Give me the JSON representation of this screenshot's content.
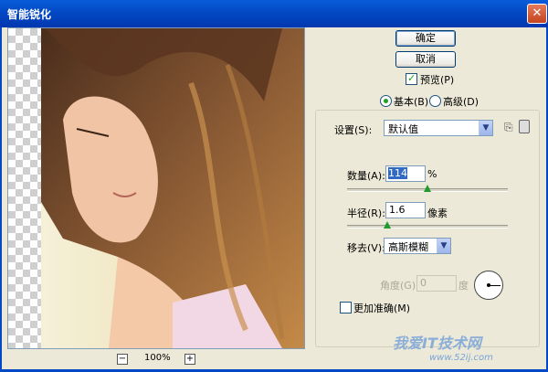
{
  "window": {
    "title": "智能锐化"
  },
  "preview": {
    "zoom": "100%"
  },
  "buttons": {
    "ok": "确定",
    "cancel": "取消"
  },
  "preview_check": {
    "label": "预览(P)",
    "checked": true
  },
  "mode": {
    "basic": "基本(B)",
    "advanced": "高级(D)",
    "selected": "basic"
  },
  "settings": {
    "label": "设置(S):",
    "value": "默认值"
  },
  "amount": {
    "label": "数量(A):",
    "value": "114",
    "unit": "%",
    "slider_fraction": 0.5
  },
  "radius": {
    "label": "半径(R):",
    "value": "1.6",
    "unit": "像素",
    "slider_fraction": 0.25
  },
  "remove": {
    "label": "移去(V):",
    "value": "高斯模糊"
  },
  "angle": {
    "label": "角度(G):",
    "value": "0",
    "unit": "度"
  },
  "accurate": {
    "label": "更加准确(M)",
    "checked": false
  },
  "watermark": {
    "text": "我爱IT技术网",
    "url": "www.52ij.com"
  }
}
